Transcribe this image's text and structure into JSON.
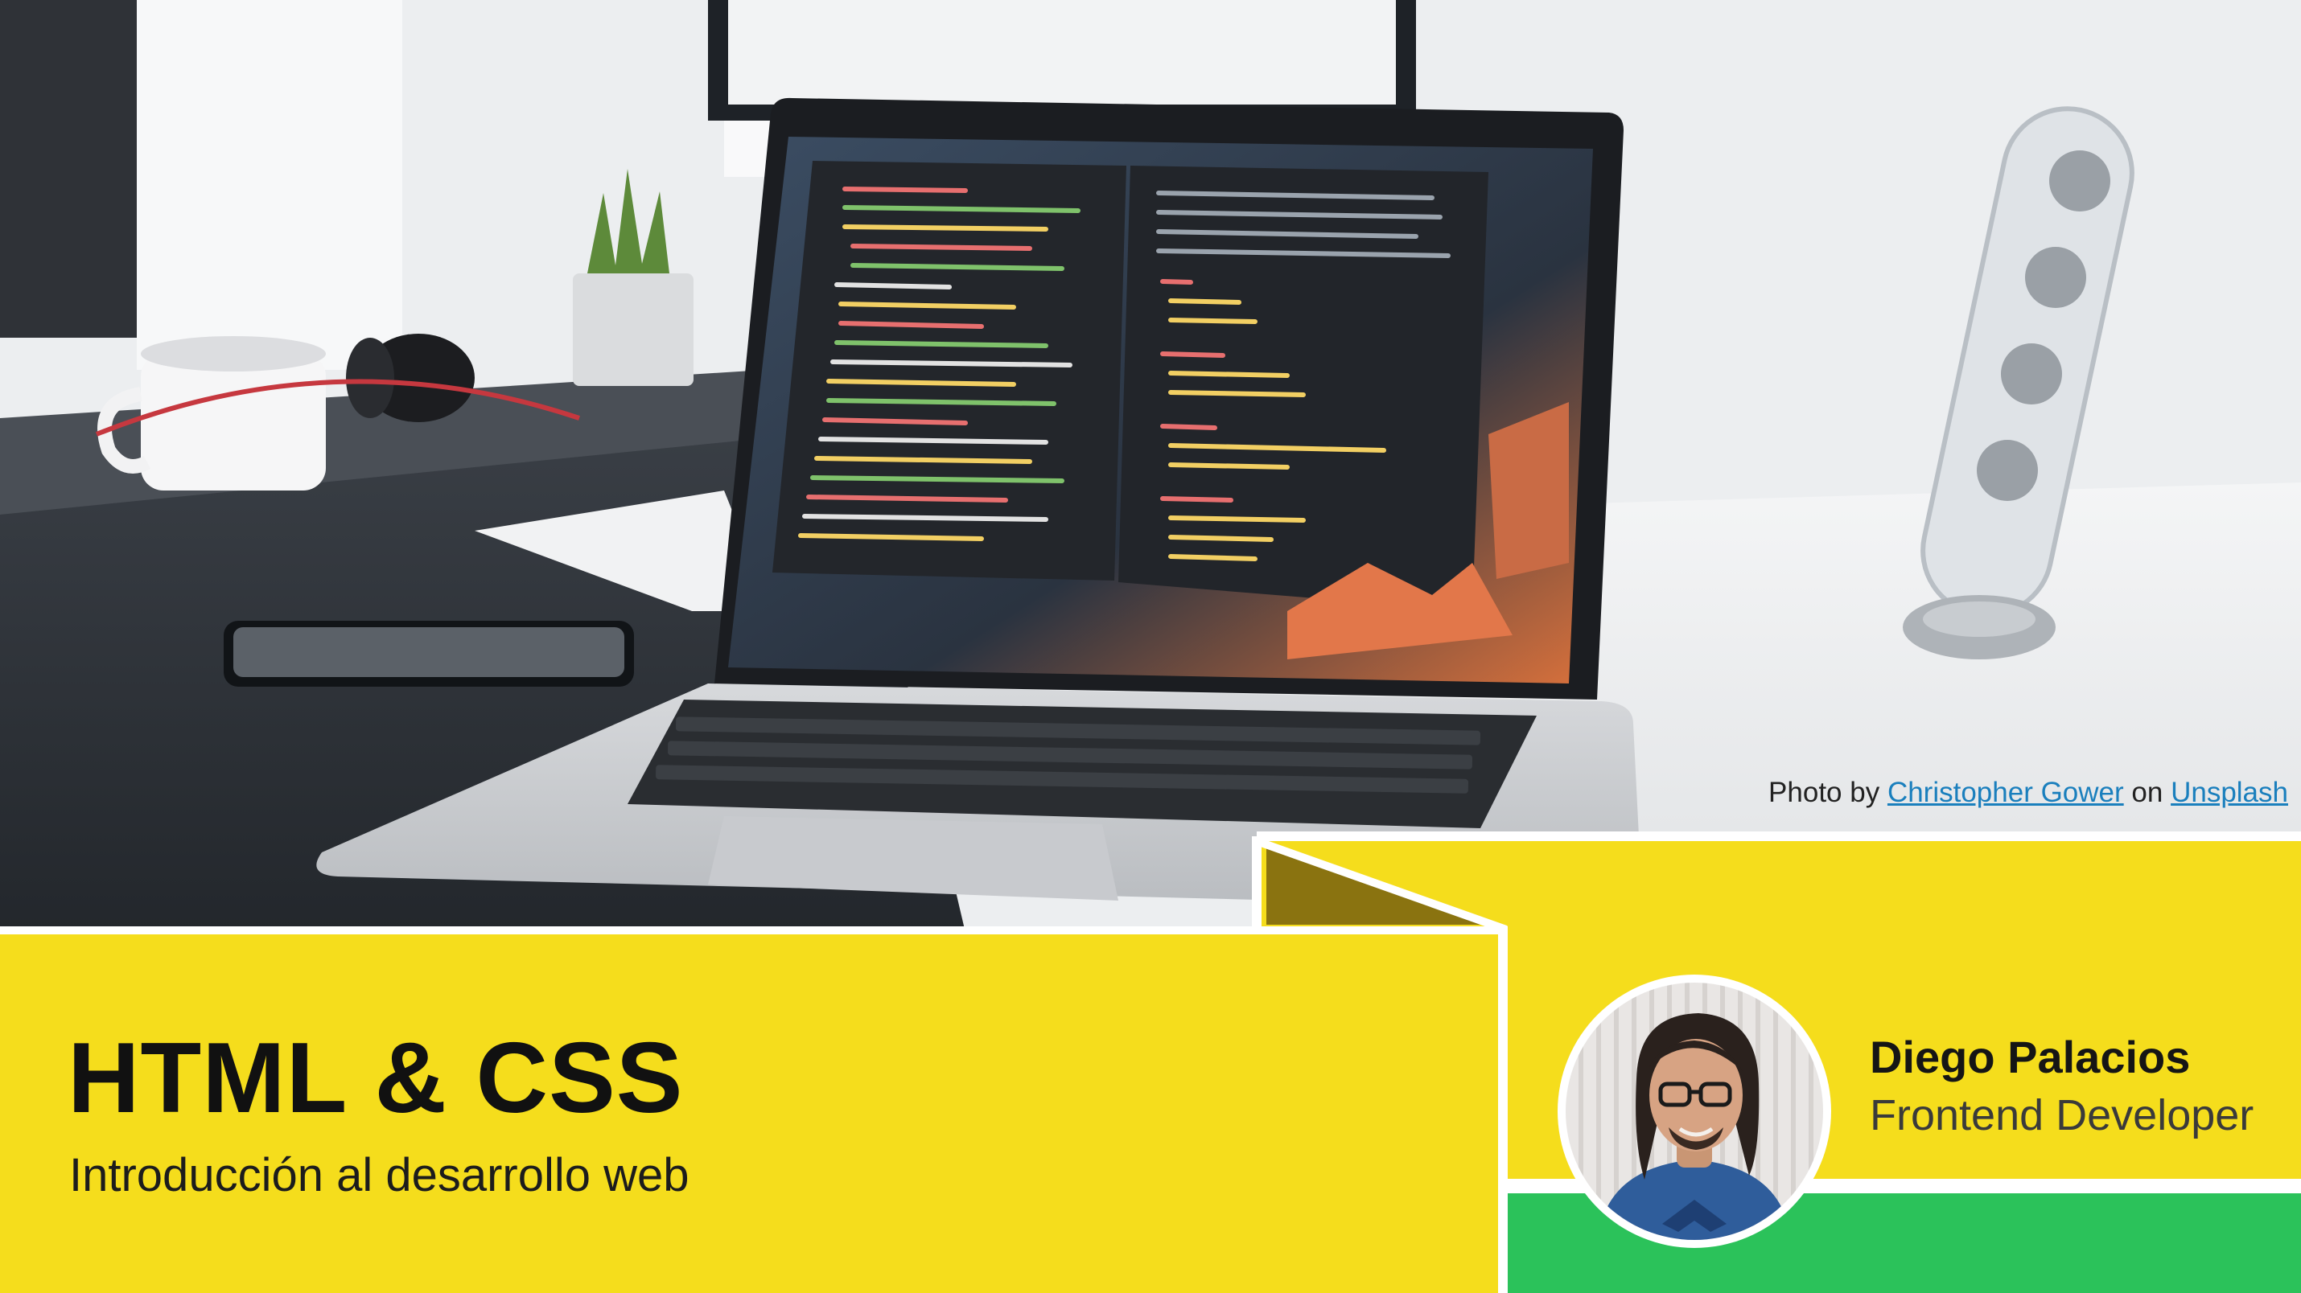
{
  "photo_credit": {
    "prefix": "Photo by",
    "author": "Christopher Gower",
    "connector": "on",
    "source": "Unsplash"
  },
  "title": "HTML & CSS",
  "subtitle": "Introducción al desarrollo web",
  "author": {
    "name": "Diego Palacios",
    "role": "Frontend Developer"
  },
  "colors": {
    "yellow": "#f5dd1c",
    "green": "#2bc25a",
    "link": "#1a7fbd",
    "title": "#111111"
  },
  "icons": [
    "laptop-illustration",
    "avatar-illustration"
  ]
}
